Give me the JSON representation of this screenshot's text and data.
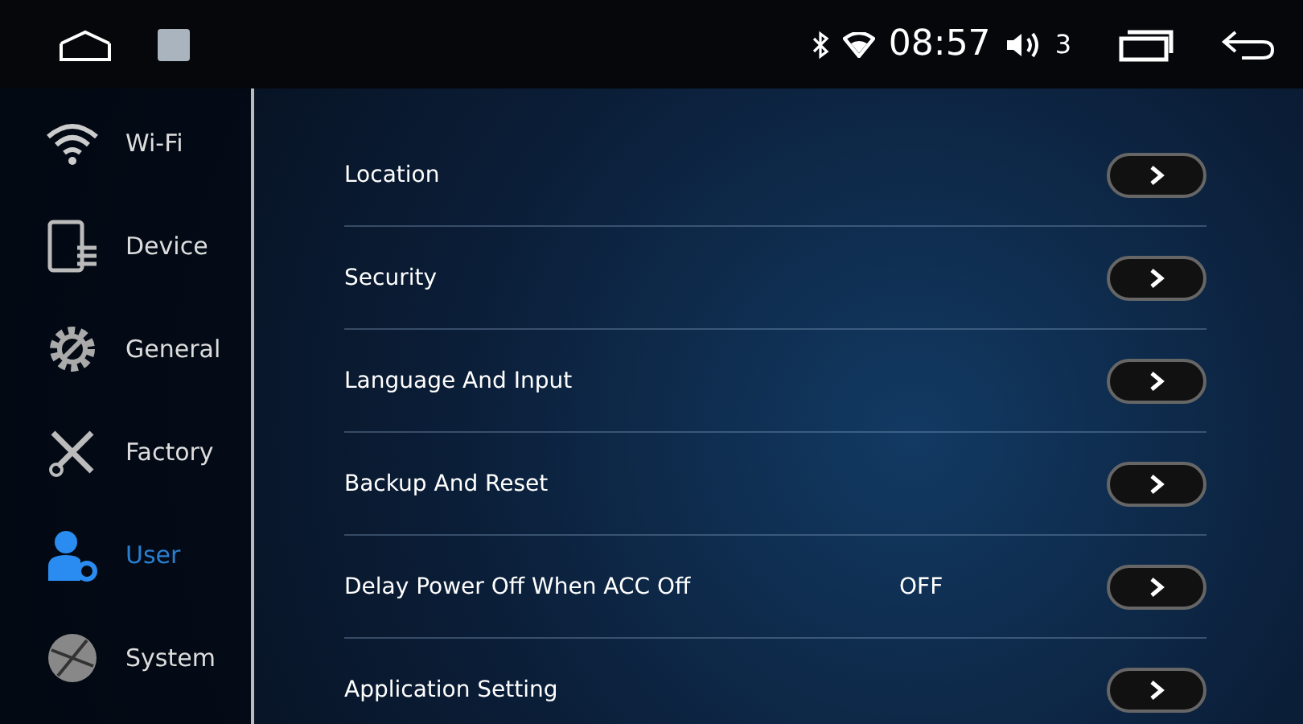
{
  "status_bar": {
    "time": "08:57",
    "volume": "3"
  },
  "sidebar": {
    "items": [
      {
        "label": "Wi-Fi",
        "selected": false
      },
      {
        "label": "Device",
        "selected": false
      },
      {
        "label": "General",
        "selected": false
      },
      {
        "label": "Factory",
        "selected": false
      },
      {
        "label": "User",
        "selected": true
      },
      {
        "label": "System",
        "selected": false
      }
    ]
  },
  "settings": [
    {
      "label": "Location"
    },
    {
      "label": "Security"
    },
    {
      "label": "Language And Input"
    },
    {
      "label": "Backup And Reset"
    },
    {
      "label": "Delay Power Off When ACC Off",
      "value": "OFF"
    },
    {
      "label": "Application Setting"
    }
  ]
}
